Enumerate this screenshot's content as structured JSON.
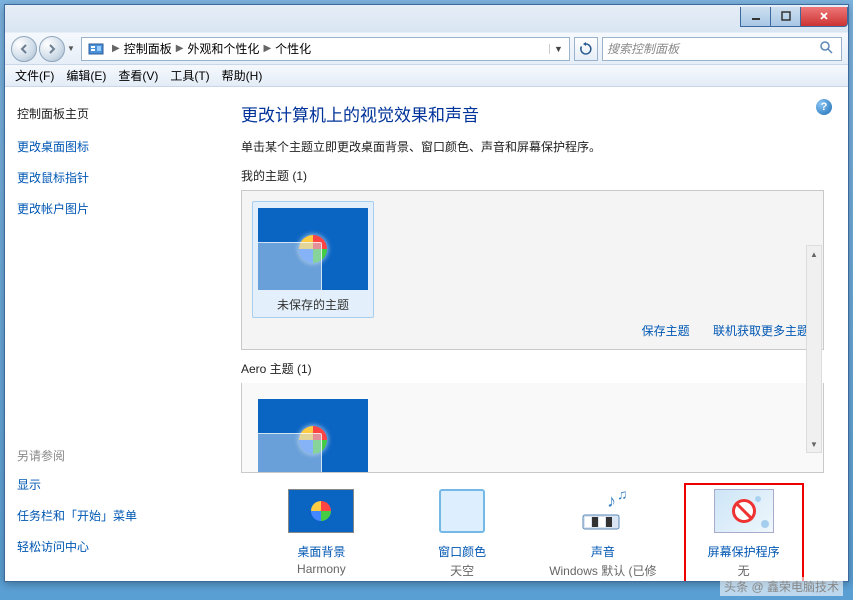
{
  "window_controls": {
    "min": "—",
    "max": "☐",
    "close": "✕"
  },
  "address": {
    "segments": [
      "控制面板",
      "外观和个性化",
      "个性化"
    ]
  },
  "search": {
    "placeholder": "搜索控制面板"
  },
  "menubar": {
    "file": "文件(F)",
    "edit": "编辑(E)",
    "view": "查看(V)",
    "tools": "工具(T)",
    "help": "帮助(H)"
  },
  "sidebar": {
    "home": "控制面板主页",
    "links": [
      "更改桌面图标",
      "更改鼠标指针",
      "更改帐户图片"
    ],
    "see_also": "另请参阅",
    "sublinks": [
      "显示",
      "任务栏和「开始」菜单",
      "轻松访问中心"
    ]
  },
  "content": {
    "title": "更改计算机上的视觉效果和声音",
    "subtitle": "单击某个主题立即更改桌面背景、窗口颜色、声音和屏幕保护程序。",
    "my_themes_label": "我的主题 (1)",
    "unsaved_theme": "未保存的主题",
    "save_theme": "保存主题",
    "get_more": "联机获取更多主题",
    "aero_label": "Aero 主题 (1)"
  },
  "bottom": {
    "items": [
      {
        "title": "桌面背景",
        "sub": "Harmony"
      },
      {
        "title": "窗口颜色",
        "sub": "天空"
      },
      {
        "title": "声音",
        "sub": "Windows 默认 (已修改)"
      },
      {
        "title": "屏幕保护程序",
        "sub": "无"
      }
    ]
  },
  "watermark": "头条 @ 鑫荣电脑技术"
}
